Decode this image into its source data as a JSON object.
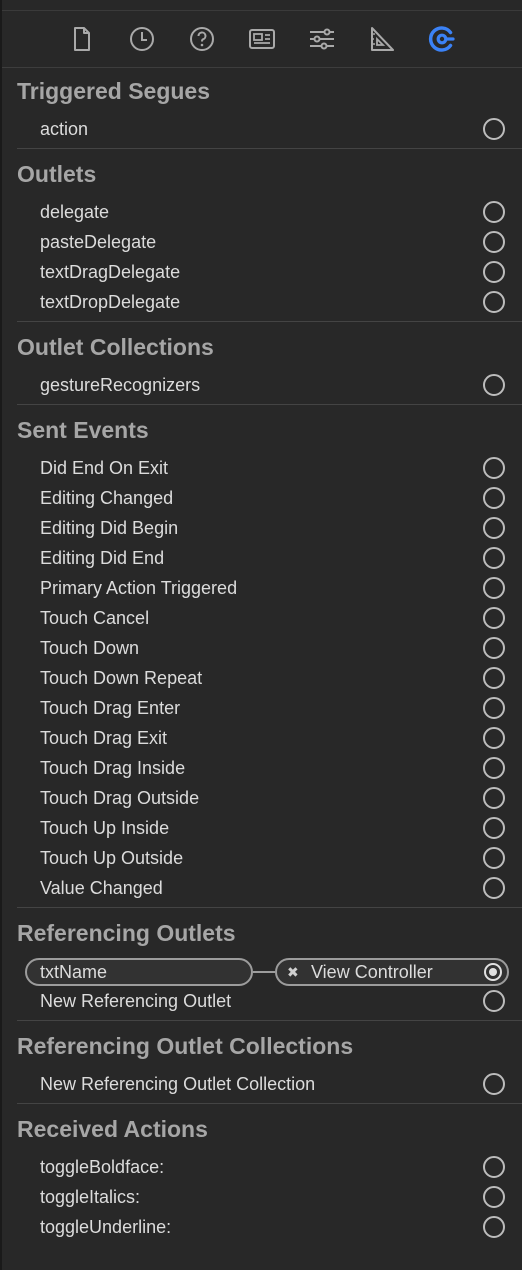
{
  "toolbar": {
    "icons": [
      "file-icon",
      "history-icon",
      "help-icon",
      "identity-icon",
      "attributes-icon",
      "size-icon",
      "connections-icon"
    ],
    "active_color": "#3b82f6"
  },
  "sections": {
    "triggered_segues": {
      "title": "Triggered Segues",
      "items": [
        "action"
      ]
    },
    "outlets": {
      "title": "Outlets",
      "items": [
        "delegate",
        "pasteDelegate",
        "textDragDelegate",
        "textDropDelegate"
      ]
    },
    "outlet_collections": {
      "title": "Outlet Collections",
      "items": [
        "gestureRecognizers"
      ]
    },
    "sent_events": {
      "title": "Sent Events",
      "items": [
        "Did End On Exit",
        "Editing Changed",
        "Editing Did Begin",
        "Editing Did End",
        "Primary Action Triggered",
        "Touch Cancel",
        "Touch Down",
        "Touch Down Repeat",
        "Touch Drag Enter",
        "Touch Drag Exit",
        "Touch Drag Inside",
        "Touch Drag Outside",
        "Touch Up Inside",
        "Touch Up Outside",
        "Value Changed"
      ]
    },
    "referencing_outlets": {
      "title": "Referencing Outlets",
      "connection": {
        "source": "txtName",
        "target": "View Controller",
        "remove_symbol": "✖"
      },
      "new_label": "New Referencing Outlet"
    },
    "referencing_outlet_collections": {
      "title": "Referencing Outlet Collections",
      "new_label": "New Referencing Outlet Collection"
    },
    "received_actions": {
      "title": "Received Actions",
      "items": [
        "toggleBoldface:",
        "toggleItalics:",
        "toggleUnderline:"
      ]
    }
  }
}
